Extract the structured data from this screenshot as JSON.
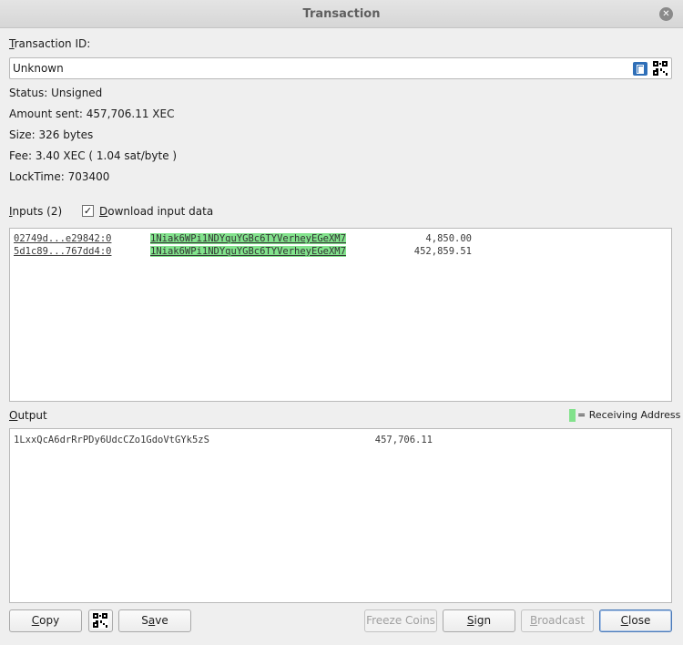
{
  "window": {
    "title": "Transaction",
    "close_icon": "close-icon"
  },
  "txid": {
    "label_prefix": "",
    "label_u": "T",
    "label_rest": "ransaction ID:",
    "value": "Unknown",
    "icons": [
      "copy-icon",
      "qr-code-icon"
    ]
  },
  "info": {
    "status": "Status: Unsigned",
    "amount": "Amount sent: 457,706.11 XEC",
    "size": "Size: 326 bytes",
    "fee": "Fee: 3.40 XEC ( 1.04 sat/byte )",
    "locktime": "LockTime: 703400"
  },
  "inputs": {
    "label_u": "I",
    "label_rest": "nputs (2)",
    "download_check": "✓",
    "download_label_u": "D",
    "download_label_rest": "ownload input data",
    "download_checked": true,
    "rows": [
      {
        "prevout": "02749d...e29842:0",
        "address": "1Niak6WPi1NDYquYGBc6TYVerheyEGeXM7",
        "amount": "4,850.00"
      },
      {
        "prevout": "5d1c89...767dd4:0",
        "address": "1Niak6WPi1NDYquYGBc6TYVerheyEGeXM7",
        "amount": "452,859.51"
      }
    ]
  },
  "output": {
    "label_u": "O",
    "label_rest": "utput",
    "legend": "= Receiving Address",
    "legend_color": "#82e28c",
    "rows": [
      {
        "address": "1LxxQcA6drRrPDy6UdcCZo1GdoVtGYk5zS",
        "amount": "457,706.11"
      }
    ]
  },
  "buttons": {
    "copy_u": "C",
    "copy_rest": "opy",
    "qr_icon": "qr-code-icon",
    "save_pre": "S",
    "save_u": "a",
    "save_rest": "ve",
    "freeze": "Freeze Coins",
    "sign_u": "S",
    "sign_rest": "ign",
    "broadcast_u": "B",
    "broadcast_rest": "roadcast",
    "close_u": "C",
    "close_rest": "lose"
  }
}
